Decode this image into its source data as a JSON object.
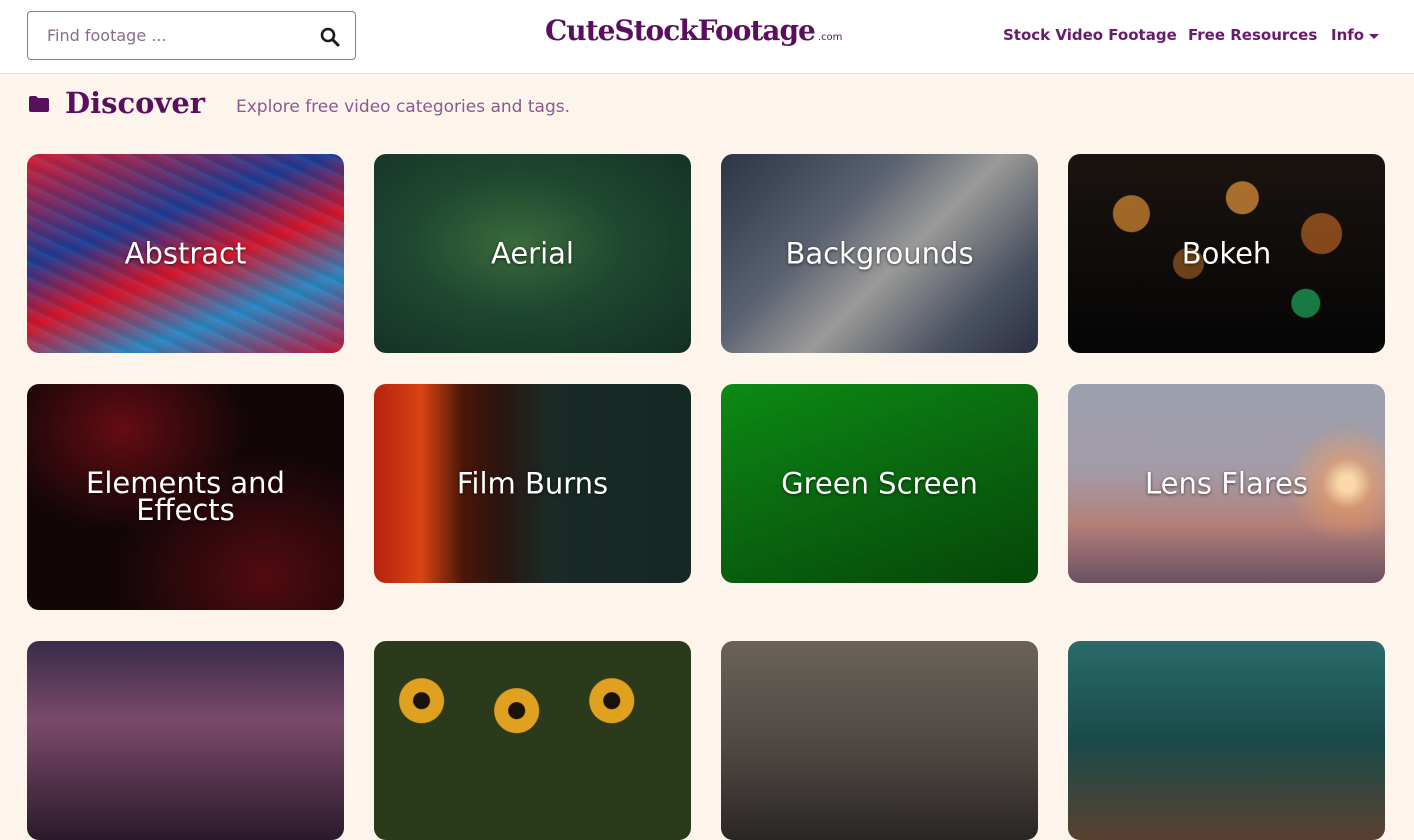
{
  "header": {
    "search_placeholder": "Find footage ...",
    "logo": "CuteStockFootage",
    "logo_suffix": ".com",
    "nav": {
      "stock": "Stock Video Footage",
      "free": "Free Resources",
      "info": "Info"
    }
  },
  "discover": {
    "title": "Discover",
    "subtitle": "Explore free video categories and tags."
  },
  "categories": [
    {
      "label": "Abstract"
    },
    {
      "label": "Aerial"
    },
    {
      "label": "Backgrounds"
    },
    {
      "label": "Bokeh"
    },
    {
      "label": "Elements and Effects"
    },
    {
      "label": "Film Burns"
    },
    {
      "label": "Green Screen"
    },
    {
      "label": "Lens Flares"
    }
  ],
  "colors": {
    "brand": "#5a0f5e",
    "page_bg": "#fdf5ec"
  }
}
